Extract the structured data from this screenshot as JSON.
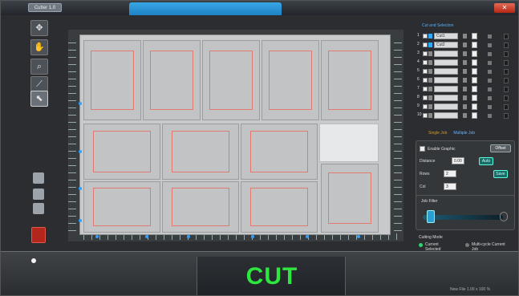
{
  "window": {
    "title": "Cutter 1.0"
  },
  "toolbar": {
    "tools": [
      {
        "icon": "move-icon"
      },
      {
        "icon": "hand-icon"
      },
      {
        "icon": "zoom-icon"
      },
      {
        "icon": "knife-icon"
      },
      {
        "icon": "pointer-icon"
      }
    ]
  },
  "layers": {
    "title": "Cut and Selection",
    "rows": [
      {
        "num": "1",
        "color": "#2da8ff",
        "name": "Cut1"
      },
      {
        "num": "2",
        "color": "#2da8ff",
        "name": "Cut2"
      },
      {
        "num": "3",
        "color": "#888888",
        "name": ""
      },
      {
        "num": "4",
        "color": "#888888",
        "name": ""
      },
      {
        "num": "5",
        "color": "#888888",
        "name": ""
      },
      {
        "num": "6",
        "color": "#888888",
        "name": ""
      },
      {
        "num": "7",
        "color": "#888888",
        "name": ""
      },
      {
        "num": "8",
        "color": "#888888",
        "name": ""
      },
      {
        "num": "9",
        "color": "#888888",
        "name": ""
      },
      {
        "num": "10",
        "color": "#888888",
        "name": ""
      }
    ]
  },
  "mode": {
    "single": "Single Job",
    "multiple": "Multiple Job"
  },
  "import": {
    "enable_label": "Enable Graphic",
    "enable_btn": "Offset",
    "distance_label": "Distance",
    "distance_value": "0.00",
    "distance_btn": "Auto",
    "rows_label": "Rows",
    "rows_value": "2",
    "cols_label": "Col",
    "cols_value": "3",
    "apply_btn": "Save"
  },
  "job_filter": {
    "title": "Job Filter",
    "level": 0.05
  },
  "cutting": {
    "title": "Cutting Mode",
    "opt1": "Current Selected",
    "opt2": "Multi-cycle Current Job"
  },
  "bottom": {
    "cut_label": "CUT",
    "status": "New File 1.00 x 100 %"
  },
  "colors": {
    "accent": "#2da8ff",
    "cut_text": "#2ee640",
    "stop": "#b3261c",
    "cell_outline": "#e2786f"
  }
}
